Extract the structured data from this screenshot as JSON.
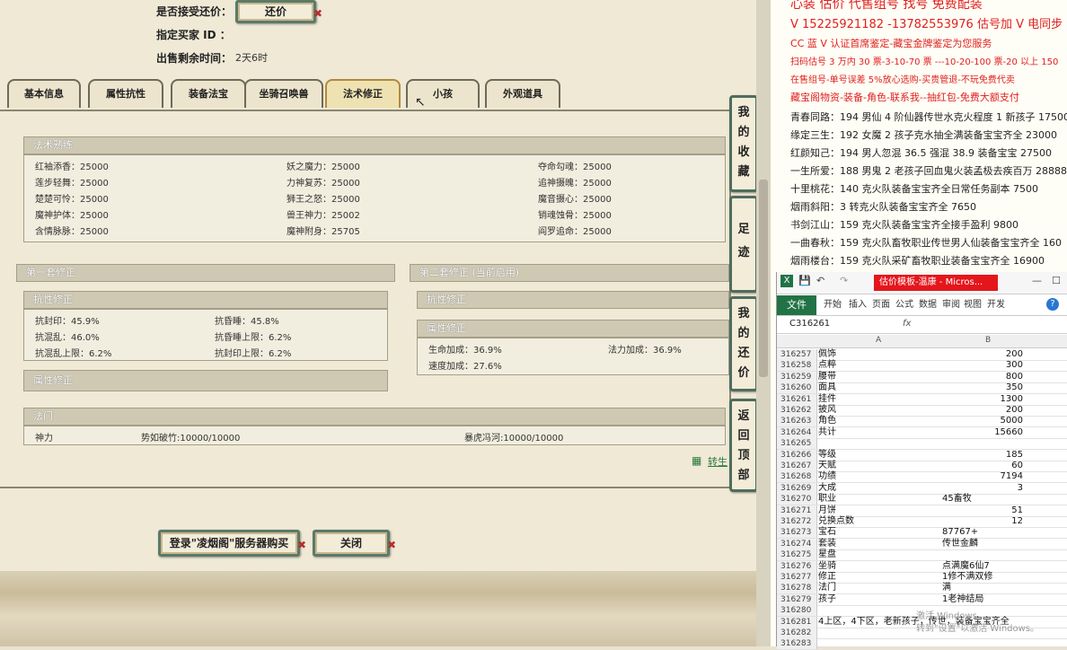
{
  "trade": {
    "accept_counter_label": "是否接受还价：",
    "counter_button": "还价",
    "buyer_id_label": "指定买家 ID ：",
    "time_left_label": "出售剩余时间：",
    "time_left_value": "2天6时"
  },
  "tabs": [
    "基本信息",
    "属性抗性",
    "装备法宝",
    "坐骑召唤兽",
    "法术修正",
    "小孩",
    "外观道具"
  ],
  "spell_mastery": {
    "title": "法术熟练",
    "col1": [
      "红袖添香：25000",
      "莲步轻舞：25000",
      "楚楚可怜：25000",
      "魔神护体：25000",
      "含情脉脉：25000"
    ],
    "col2": [
      "妖之魔力：25000",
      "力神复苏：25000",
      "狮王之怒：25000",
      "兽王神力：25002",
      "魔神附身：25705"
    ],
    "col3": [
      "夺命勾魂：25000",
      "追神摄魄：25000",
      "魔音摄心：25000",
      "销魂蚀骨：25000",
      "阎罗追命：25000"
    ]
  },
  "set1": {
    "title": "第一套修正",
    "resist_title": "抗性修正",
    "resists": [
      "抗封印：45.9%",
      "抗混乱：46.0%",
      "抗混乱上限：6.2%",
      "抗昏睡：45.8%",
      "抗昏睡上限：6.2%",
      "抗封印上限：6.2%"
    ],
    "attr_title": "属性修正"
  },
  "set2": {
    "title": "第二套修正 (当前启用)",
    "resist_title": "抗性修正",
    "attr_title": "属性修正",
    "attrs": [
      "生命加成：36.9%",
      "法力加成：36.9%",
      "速度加成：27.6%"
    ]
  },
  "magic": {
    "title": "法门",
    "name": "神力",
    "item1": "势如破竹:10000/10000",
    "item2": "暴虎冯河:10000/10000"
  },
  "side_buttons": [
    "我的收藏",
    "足迹",
    "我的还价",
    "返回顶部"
  ],
  "bottom_buttons": {
    "buy": "登录\"凌烟阁\"服务器购买",
    "close": "关闭"
  },
  "link_text": "转生",
  "ads": {
    "line0": "心装 估价 代售组号 找号 免费配装",
    "line1": "V 15225921182 -13782553976 估号加 V 电同步",
    "line2": "CC 蓝 V 认证首席鉴定-藏宝金牌鉴定为您服务",
    "line3": "扫码估号 3 万内 30 票-3-10-70 票 ---10-20-100 票-20 以上 150",
    "line4": "在售组号-单号误差 5%放心选购-买贵管退-不玩免费代卖",
    "line5": "藏宝阁物资-装备-角色-联系我--抽红包-免费大额支付",
    "entries": [
      "青春同路：194 男仙 4 阶仙器传世水克火程度 1 新孩子 17500",
      "缘定三生：192 女魔 2 孩子克水抽全满装备宝宝齐全 23000",
      "红颜知己：194 男人忽混 36.5 强混 38.9 装备宝宝 27500",
      "一生所爱：188 男鬼 2 老孩子回血鬼火装孟极去疾百万 28888",
      "十里桃花：140 克火队装备宝宝齐全日常任务副本 7500",
      "烟雨斜阳：3 转克火队装备宝宝齐全 7650",
      "书剑江山：159 克火队装备宝宝齐全接手盈利 9800",
      "一曲春秋：159 克火队畜牧职业传世男人仙装备宝宝齐全 160",
      "烟雨楼台：159 克火队采矿畜牧职业装备宝宝齐全 16900"
    ]
  },
  "excel": {
    "title": "估价模板-温康 - Micros...",
    "file_tab": "文件",
    "tabs": [
      "开始",
      "插入",
      "页面",
      "公式",
      "数据",
      "审阅",
      "视图",
      "开发"
    ],
    "name_box": "C316261",
    "fx": "fx",
    "col_a": "A",
    "col_b": "B",
    "rows": [
      {
        "n": "316257",
        "a": "佩饰",
        "b": "200"
      },
      {
        "n": "316258",
        "a": "点粹",
        "b": "300"
      },
      {
        "n": "316259",
        "a": "腰带",
        "b": "800"
      },
      {
        "n": "316260",
        "a": "面具",
        "b": "350"
      },
      {
        "n": "316261",
        "a": "挂件",
        "b": "1300"
      },
      {
        "n": "316262",
        "a": "披风",
        "b": "200"
      },
      {
        "n": "316263",
        "a": "角色",
        "b": "5000"
      },
      {
        "n": "316264",
        "a": "共计",
        "b": "15660"
      },
      {
        "n": "316265",
        "a": "",
        "b": ""
      },
      {
        "n": "316266",
        "a": "等级",
        "b": "185"
      },
      {
        "n": "316267",
        "a": "天赋",
        "b": "60"
      },
      {
        "n": "316268",
        "a": "功绩",
        "b": "7194"
      },
      {
        "n": "316269",
        "a": "大成",
        "b": "3"
      },
      {
        "n": "316270",
        "a": "职业",
        "bl": "45畜牧"
      },
      {
        "n": "316271",
        "a": "月饼",
        "b": "51"
      },
      {
        "n": "316272",
        "a": "兑换点数",
        "b": "12"
      },
      {
        "n": "316273",
        "a": "宝石",
        "bl": "87767+"
      },
      {
        "n": "316274",
        "a": "套装",
        "bl": "传世金麟"
      },
      {
        "n": "316275",
        "a": "星盘",
        "bl": ""
      },
      {
        "n": "316276",
        "a": "坐骑",
        "bl": "点满魔6仙7"
      },
      {
        "n": "316277",
        "a": "修正",
        "bl": "1修不满双修"
      },
      {
        "n": "316278",
        "a": "法门",
        "bl": "满"
      },
      {
        "n": "316279",
        "a": "孩子",
        "bl": "1老神结局"
      },
      {
        "n": "316280",
        "a": "",
        "bl": ""
      },
      {
        "n": "316281",
        "a": "4上区，4下区，老新孩子，传世，装备宝宝齐全",
        "bl": ""
      },
      {
        "n": "316282",
        "a": "",
        "bl": ""
      },
      {
        "n": "316283",
        "a": "",
        "bl": ""
      }
    ],
    "watermark1": "激活 Windows",
    "watermark2": "转到\"设置\"以激活 Windows。"
  }
}
